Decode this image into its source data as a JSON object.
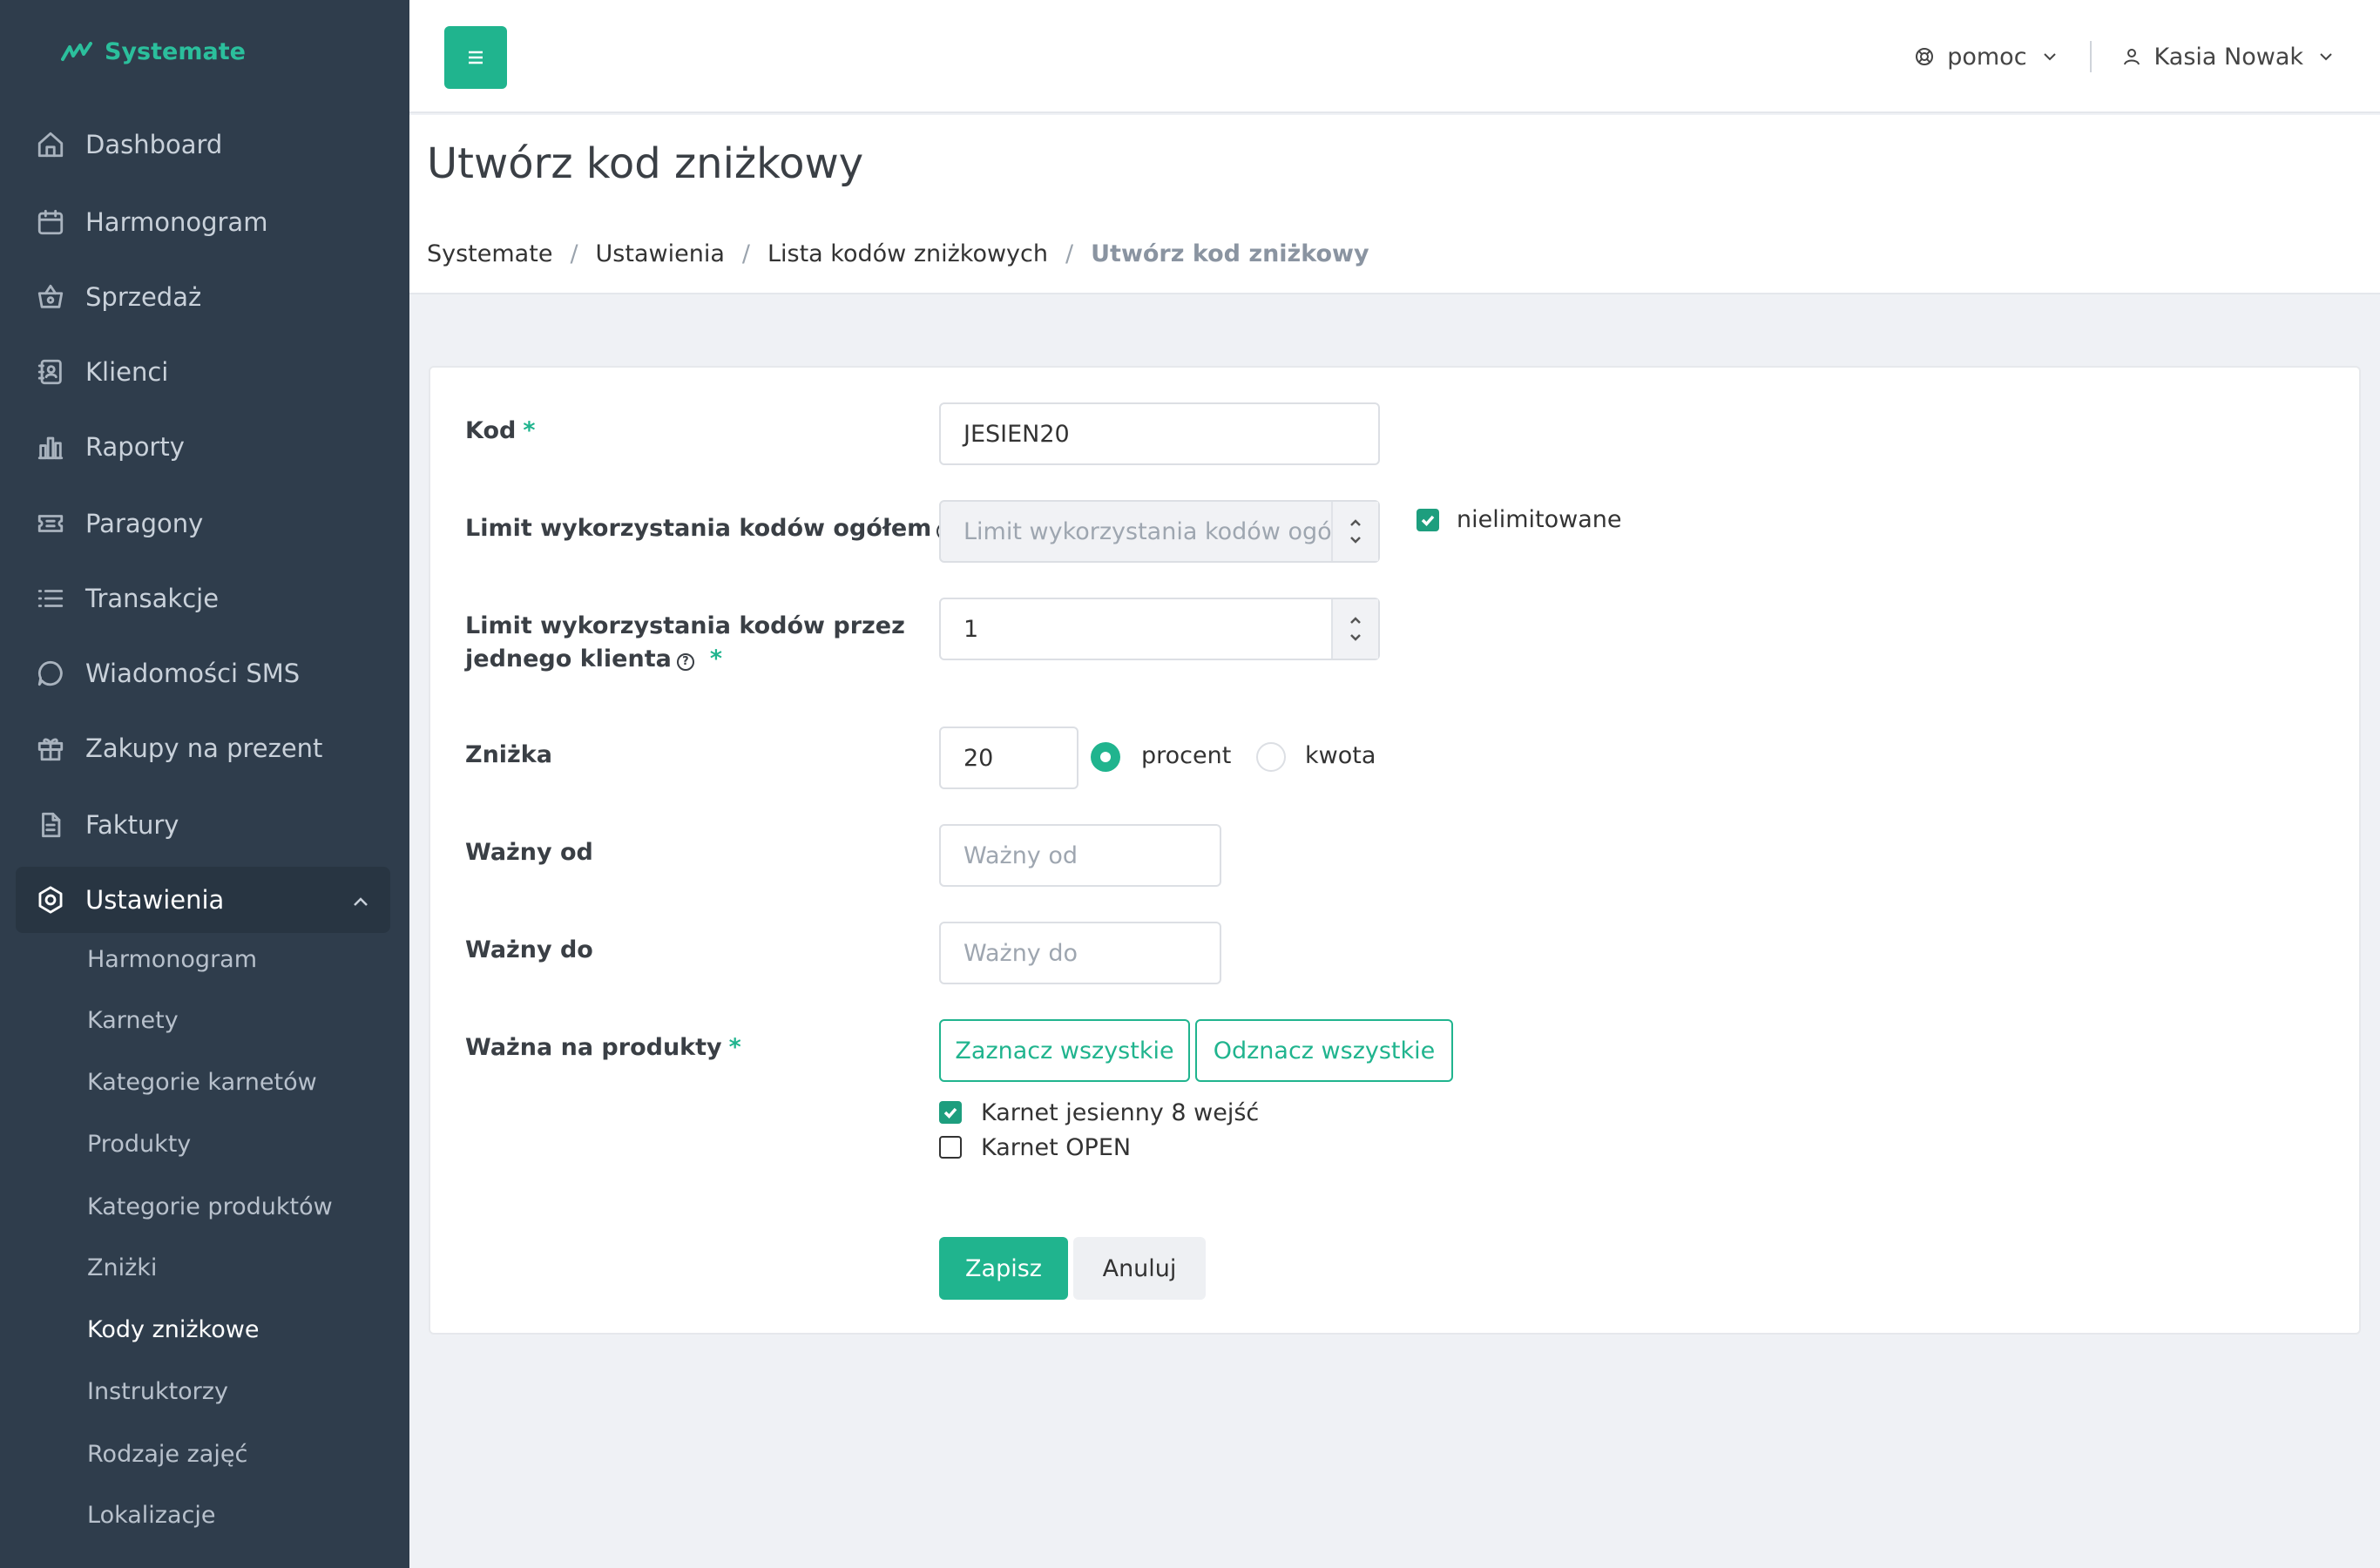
{
  "app": {
    "brand": "Systemate"
  },
  "sidebar": {
    "items": [
      {
        "label": "Dashboard",
        "icon": "home-icon"
      },
      {
        "label": "Harmonogram",
        "icon": "calendar-icon"
      },
      {
        "label": "Sprzedaż",
        "icon": "basket-icon"
      },
      {
        "label": "Klienci",
        "icon": "contacts-icon"
      },
      {
        "label": "Raporty",
        "icon": "bar-chart-icon"
      },
      {
        "label": "Paragony",
        "icon": "ticket-icon"
      },
      {
        "label": "Transakcje",
        "icon": "list-icon"
      },
      {
        "label": "Wiadomości SMS",
        "icon": "chat-icon"
      },
      {
        "label": "Zakupy na prezent",
        "icon": "gift-icon"
      },
      {
        "label": "Faktury",
        "icon": "document-icon"
      },
      {
        "label": "Ustawienia",
        "icon": "settings-icon"
      }
    ],
    "subitems": [
      "Harmonogram",
      "Karnety",
      "Kategorie karnetów",
      "Produkty",
      "Kategorie produktów",
      "Zniżki",
      "Kody zniżkowe",
      "Instruktorzy",
      "Rodzaje zajęć",
      "Lokalizacje"
    ]
  },
  "topbar": {
    "help_label": "pomoc",
    "user_name": "Kasia Nowak"
  },
  "page": {
    "title": "Utwórz kod zniżkowy",
    "breadcrumb": [
      "Systemate",
      "Ustawienia",
      "Lista kodów zniżkowych",
      "Utwórz kod zniżkowy"
    ]
  },
  "form": {
    "code": {
      "label": "Kod",
      "value": "JESIEN20"
    },
    "total_limit": {
      "label": "Limit wykorzystania kodów ogółem",
      "placeholder": "Limit wykorzystania kodów ogółe",
      "unlimited_label": "nielimitowane",
      "unlimited_checked": true
    },
    "client_limit": {
      "label_line1": "Limit wykorzystania kodów przez",
      "label_line2": "jednego klienta",
      "value": "1"
    },
    "discount": {
      "label": "Zniżka",
      "value": "20",
      "option_percent": "procent",
      "option_amount": "kwota",
      "selected": "procent"
    },
    "valid_from": {
      "label": "Ważny od",
      "placeholder": "Ważny od"
    },
    "valid_to": {
      "label": "Ważny do",
      "placeholder": "Ważny do"
    },
    "products": {
      "label": "Ważna na produkty",
      "select_all": "Zaznacz wszystkie",
      "deselect_all": "Odznacz wszystkie",
      "items": [
        {
          "label": "Karnet jesienny 8 wejść",
          "checked": true
        },
        {
          "label": "Karnet OPEN",
          "checked": false
        }
      ]
    },
    "save": "Zapisz",
    "cancel": "Anuluj",
    "required_mark": "*"
  },
  "colors": {
    "accent": "#20b48e",
    "sidebar_bg": "#2f3d4c"
  }
}
